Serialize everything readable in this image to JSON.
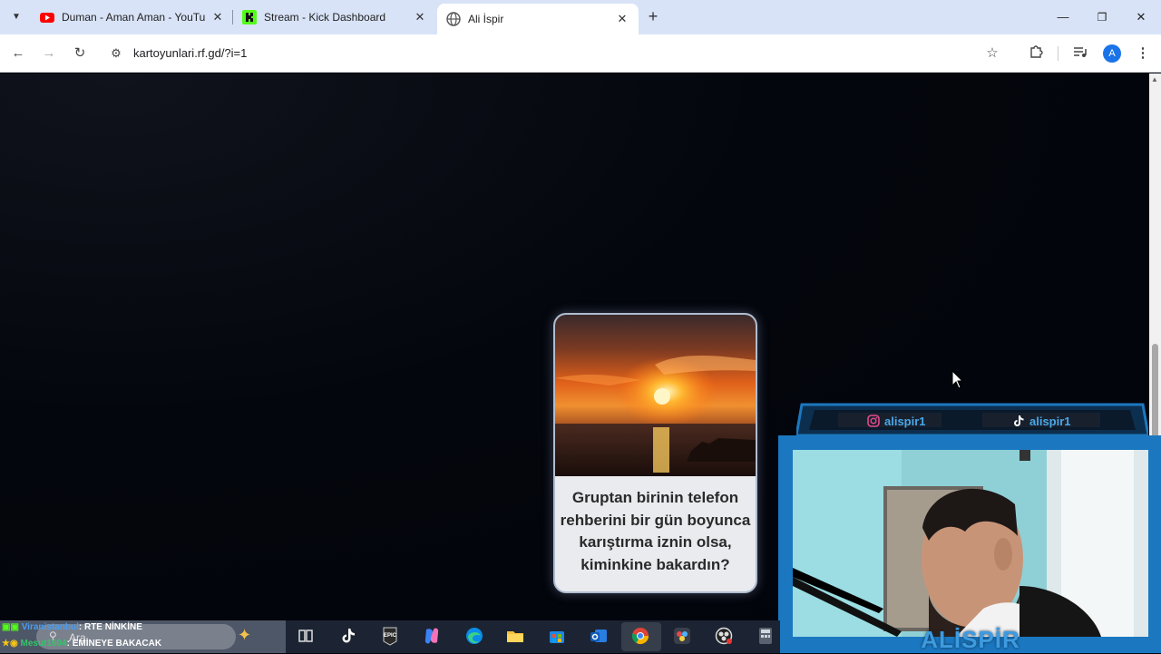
{
  "browser": {
    "tabs": [
      {
        "title": "Duman - Aman Aman - YouTube",
        "favicon": "youtube-icon",
        "color": "#ff0000"
      },
      {
        "title": "Stream - Kick Dashboard",
        "favicon": "kick-icon",
        "color": "#53fc18"
      },
      {
        "title": "Ali İspir",
        "favicon": "globe-icon",
        "active": true
      }
    ],
    "url": "kartoyunlari.rf.gd/?i=1",
    "profile_initial": "A"
  },
  "card": {
    "question": "Gruptan birinin telefon\nrehberini bir gün boyunca\nkarıştırma iznin olsa,\nkiminkine bakardın?"
  },
  "overlay": {
    "instagram": "alispir1",
    "tiktok": "alispir1",
    "name": "ALİSPİR",
    "accent_color": "#1b78c0"
  },
  "chat": [
    {
      "user": "Viranistanbul",
      "message": ": RTE NİNKİNE"
    },
    {
      "user": "Mesut1604",
      "message": ": EMİNEYE BAKACAK"
    }
  ],
  "taskbar": {
    "search_label": "Ara",
    "apps": [
      "task-view-icon",
      "tiktok-icon",
      "epic-games-icon",
      "copilot-icon",
      "edge-icon",
      "file-explorer-icon",
      "store-icon",
      "outlook-icon",
      "chrome-icon",
      "davinci-icon",
      "obs-icon",
      "calculator-icon"
    ]
  }
}
